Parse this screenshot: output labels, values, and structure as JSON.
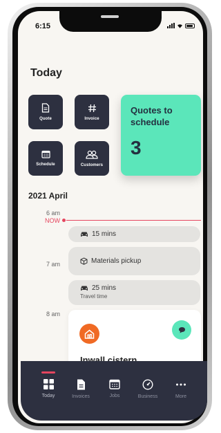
{
  "status_bar": {
    "time": "6:15"
  },
  "page": {
    "title": "Today"
  },
  "quick_actions": [
    {
      "label": "Quote",
      "icon": "document-icon"
    },
    {
      "label": "Invoice",
      "icon": "hash-icon"
    },
    {
      "label": "Schedule",
      "icon": "calendar-icon"
    },
    {
      "label": "Customers",
      "icon": "people-icon"
    }
  ],
  "quotes_card": {
    "title": "Quotes to schedule",
    "count": "3",
    "color": "#5be6ba"
  },
  "schedule": {
    "date": "2021 April",
    "times": [
      "6 am",
      "7 am",
      "8 am"
    ],
    "now_label": "NOW",
    "items": [
      {
        "icon": "car-icon",
        "text": "15 mins"
      },
      {
        "icon": "box-icon",
        "text": "Materials pickup"
      },
      {
        "icon": "car-icon",
        "text": "25 mins",
        "subtext": "Travel time"
      }
    ],
    "job": {
      "title": "Inwall cistern",
      "logo_icon": "home-logo-icon",
      "action_icon": "chat-icon"
    }
  },
  "tab_bar": {
    "active": "Today",
    "tabs": [
      {
        "label": "Today",
        "icon": "grid-icon"
      },
      {
        "label": "Invoices",
        "icon": "document-icon"
      },
      {
        "label": "Jobs",
        "icon": "calendar-icon"
      },
      {
        "label": "Business",
        "icon": "speedometer-icon"
      },
      {
        "label": "More",
        "icon": "more-icon"
      }
    ]
  },
  "colors": {
    "accent": "#5be6ba",
    "now": "#e5455f",
    "dark": "#2d3040",
    "brand_orange": "#f06a24"
  }
}
